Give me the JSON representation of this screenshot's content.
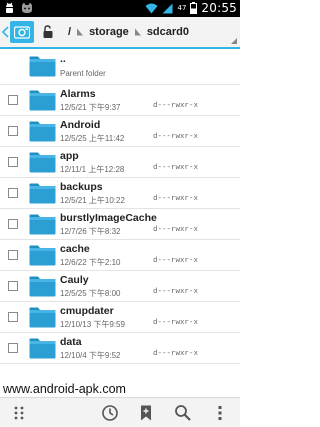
{
  "status_bar": {
    "time": "20:55",
    "battery_level": "47",
    "left_icons": [
      "android-debug-icon",
      "cat-face-icon"
    ],
    "right_icons": [
      "wifi-icon",
      "signal-icon",
      "battery-icon"
    ]
  },
  "path_bar": {
    "root": "/",
    "segments": [
      "storage",
      "sdcard0"
    ],
    "accent_color": "#33b5e5"
  },
  "parent_folder": {
    "name": "..",
    "label": "Parent folder"
  },
  "files": [
    {
      "name": "Alarms",
      "date": "12/5/21 下午9:37",
      "perm": "d---rwxr-x"
    },
    {
      "name": "Android",
      "date": "12/5/25 上午11:42",
      "perm": "d---rwxr-x"
    },
    {
      "name": "app",
      "date": "12/11/1 上午12:28",
      "perm": "d---rwxr-x"
    },
    {
      "name": "backups",
      "date": "12/5/21 上午10:22",
      "perm": "d---rwxr-x"
    },
    {
      "name": "burstlyImageCache",
      "date": "12/7/26 下午8:32",
      "perm": "d---rwxr-x"
    },
    {
      "name": "cache",
      "date": "12/6/22 下午2:10",
      "perm": "d---rwxr-x"
    },
    {
      "name": "Cauly",
      "date": "12/5/25 下午8:00",
      "perm": "d---rwxr-x"
    },
    {
      "name": "cmupdater",
      "date": "12/10/13 下午9:59",
      "perm": "d---rwxr-x"
    },
    {
      "name": "data",
      "date": "12/10/4 下午9:52",
      "perm": "d---rwxr-x"
    }
  ],
  "watermark": "www.android-apk.com",
  "bottom_bar": {
    "icons": [
      "grid-handle-icon",
      "history-clock-icon",
      "bookmark-add-icon",
      "search-icon",
      "overflow-menu-icon"
    ]
  }
}
